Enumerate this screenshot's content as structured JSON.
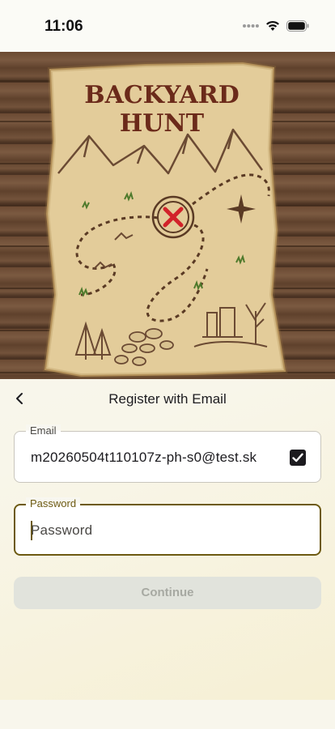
{
  "status_bar": {
    "time": "11:06",
    "icons": [
      "dots-icon",
      "wifi-icon",
      "battery-icon"
    ]
  },
  "hero": {
    "map_title": "BACKYARD HUNT",
    "icons": [
      "treasure-map-icon",
      "x-mark-icon",
      "compass-rose-icon",
      "mountains-icon",
      "trees-icon"
    ]
  },
  "header": {
    "title": "Register with Email",
    "back_icon": "chevron-left-icon"
  },
  "email_field": {
    "label": "Email",
    "value": "m20260504t110107z-ph-s0@test.sk",
    "checked": true
  },
  "password_field": {
    "label": "Password",
    "placeholder": "Password",
    "value": ""
  },
  "continue_button": {
    "label": "Continue",
    "enabled": false
  },
  "colors": {
    "accent": "#6d5a12",
    "map_title": "#6b2a1a",
    "x_mark": "#d2232a",
    "disabled_button": "#e1e3dc"
  }
}
